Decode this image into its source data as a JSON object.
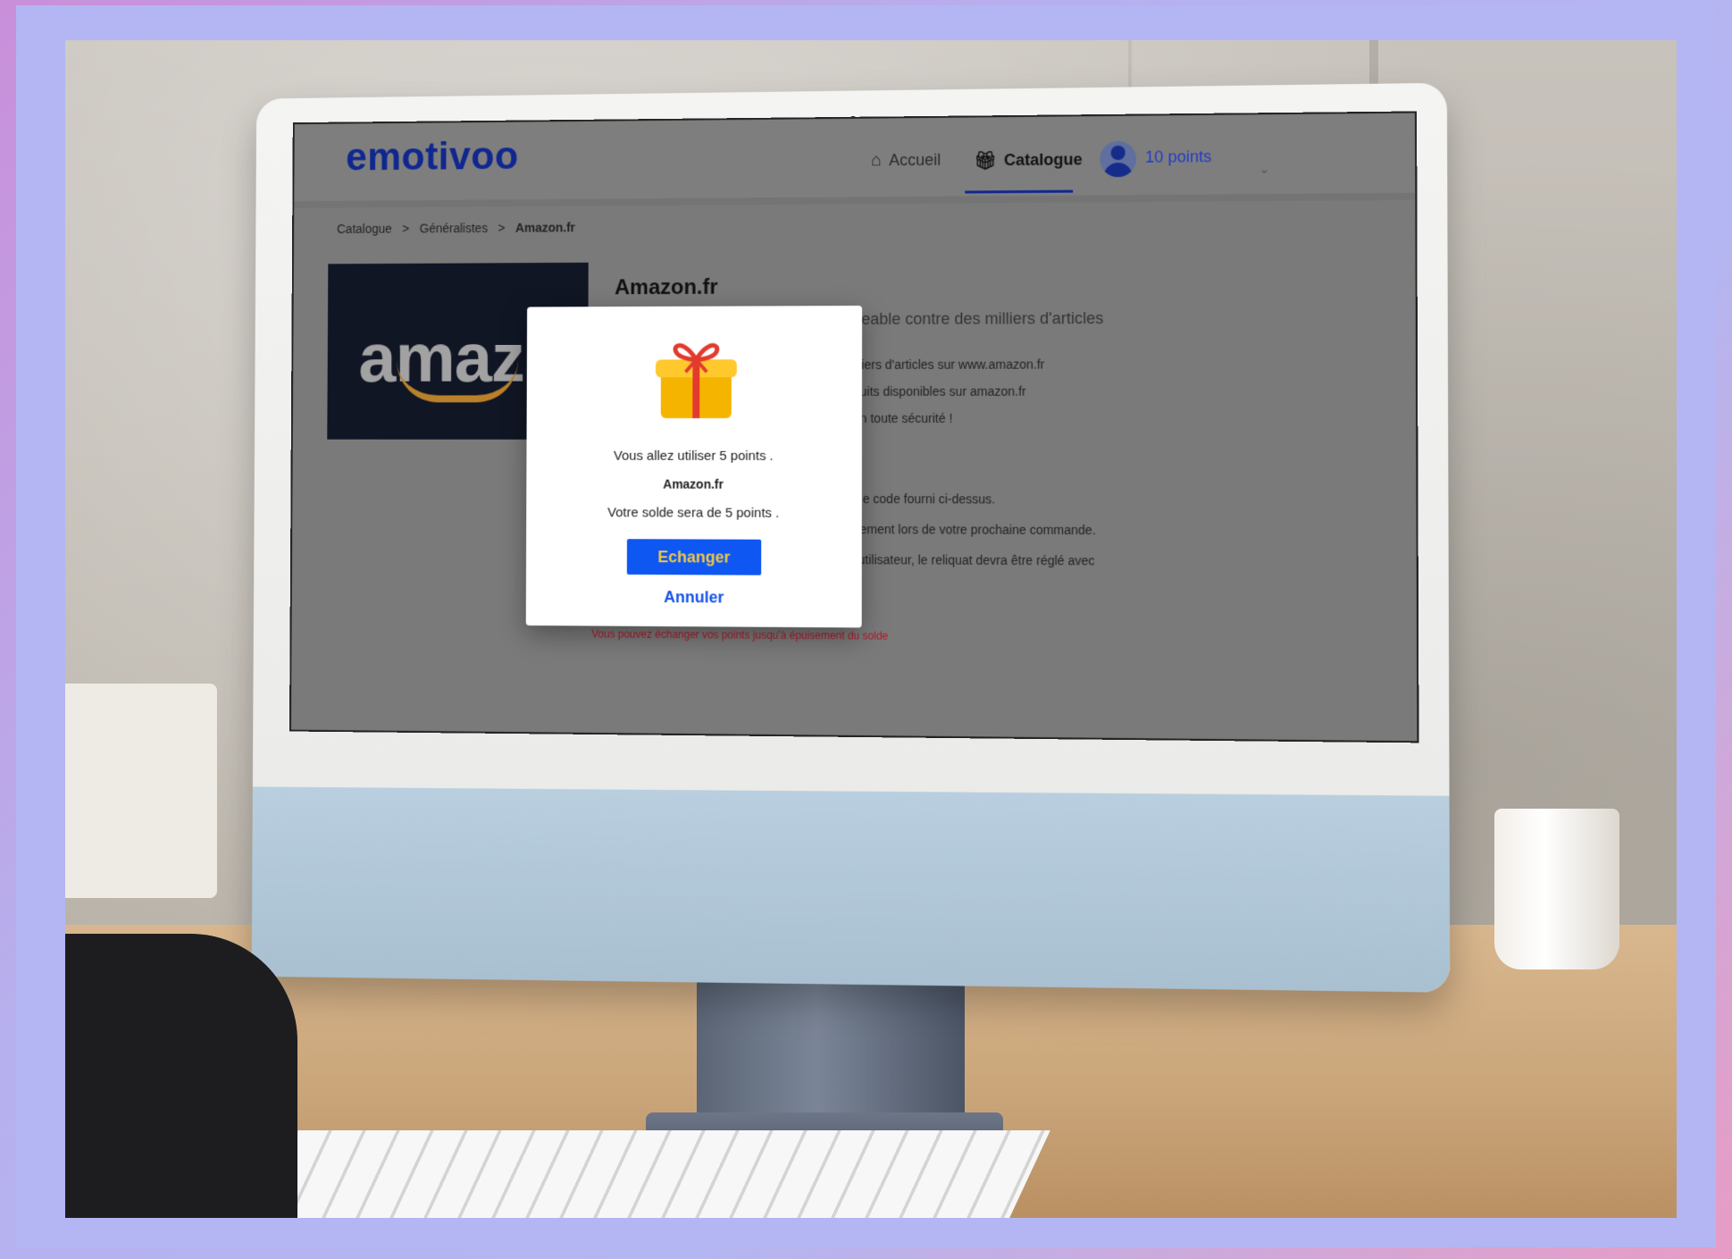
{
  "brand": {
    "logo_text": "emotivoo",
    "logo_color": "#10278f"
  },
  "nav": {
    "home_label": "Accueil",
    "home_icon": "home-icon",
    "catalog_label": "Catalogue",
    "catalog_icon": "gift-icon",
    "points_label": "10 points"
  },
  "breadcrumb": {
    "items": [
      "Catalogue",
      "Généralistes",
      "Amazon.fr"
    ],
    "separator": ">"
  },
  "product": {
    "image_word": "amazon",
    "title": "Amazon.fr",
    "description": "La carte cadeau Amazon.fr échangeable contre des milliers d'articles sur",
    "features": [
      "illiers d'articles sur www.amazon.fr",
      "duits disponibles sur amazon.fr",
      "en toute sécurité !"
    ],
    "howto": [
      "t le code fourni ci-dessus.",
      "uement lors de votre prochaine commande.",
      "l'utilisateur, le reliquat devra être réglé avec"
    ]
  },
  "footer_note": "Vous pouvez échanger vos points jusqu'à épuisement du solde",
  "modal": {
    "icon": "gift-icon",
    "use_text": "Vous allez utiliser 5 points .",
    "product_name": "Amazon.fr",
    "balance_text": "Votre solde sera de 5 points .",
    "exchange_label": "Echanger",
    "cancel_label": "Annuler",
    "exchange_color": "#0f57f2"
  }
}
